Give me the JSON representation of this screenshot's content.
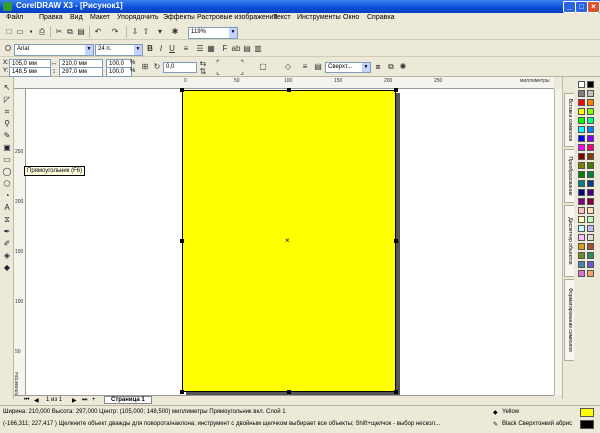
{
  "window": {
    "title": "CorelDRAW X3 - [Рисунок1]"
  },
  "menu": [
    "Файл",
    "Правка",
    "Вид",
    "Макет",
    "Упорядочить",
    "Эффекты",
    "Растровые изображения",
    "Текст",
    "Инструменты",
    "Окно",
    "Справка"
  ],
  "standard_toolbar": {
    "zoom": "119%"
  },
  "text_toolbar": {
    "font": "Arial",
    "size": "24 п."
  },
  "property_bar": {
    "x": "105,0 мм",
    "y": "148,5 мм",
    "width": "210,0 мм",
    "height": "297,0 мм",
    "scale_w": "100,0",
    "scale_h": "100,0",
    "percent": "%",
    "corner": "0,0",
    "wrap": "Сверхт..."
  },
  "ruler": {
    "units": "миллиметры",
    "hticks": [
      "0",
      "50",
      "100",
      "150",
      "200",
      "250"
    ],
    "vticks": [
      "250",
      "200",
      "150",
      "100",
      "50"
    ],
    "vunits": "миллиметры"
  },
  "tooltip": "Прямоугольник (F6)",
  "page_nav": {
    "counter": "1 из 1",
    "tab": "Страница 1"
  },
  "dockers": [
    "Вставка символов",
    "Преобразование",
    "Диспетчер объектов",
    "Форматирование символов"
  ],
  "status": {
    "line1": "Ширина: 210,000  Высота: 297,000  Центр: (105,000; 148,500)  миллиметры      Прямоугольник вкл. Слой 1",
    "line2": "(-166,311; 227,417 )   Щелкните объект дважды для поворота/наклона; инструмент с двойным щелчком выбирает все объекты; Shift+щелчок - выбор нескол...",
    "fill_name": "Yellow",
    "outline_name": "Black  Сверхтонкий абрис",
    "fill_color": "#FFFF00",
    "outline_color": "#000000"
  },
  "palette_colors": [
    "#FFFFFF",
    "#000000",
    "#808080",
    "#C0C0C0",
    "#FF0000",
    "#FF8000",
    "#FFFF00",
    "#80FF00",
    "#00FF00",
    "#00FF80",
    "#00FFFF",
    "#0080FF",
    "#0000FF",
    "#8000FF",
    "#FF00FF",
    "#FF0080",
    "#800000",
    "#804000",
    "#808000",
    "#408000",
    "#008000",
    "#008040",
    "#008080",
    "#004080",
    "#000080",
    "#400080",
    "#800080",
    "#800040",
    "#FFC0C0",
    "#FFE0C0",
    "#FFFFC0",
    "#C0FFC0",
    "#C0FFFF",
    "#C0C0FF",
    "#FFC0FF",
    "#E0E0E0",
    "#D4A017",
    "#A0522D",
    "#6B8E23",
    "#2E8B57",
    "#4682B4",
    "#6A5ACD",
    "#DA70D6",
    "#F4A460"
  ]
}
